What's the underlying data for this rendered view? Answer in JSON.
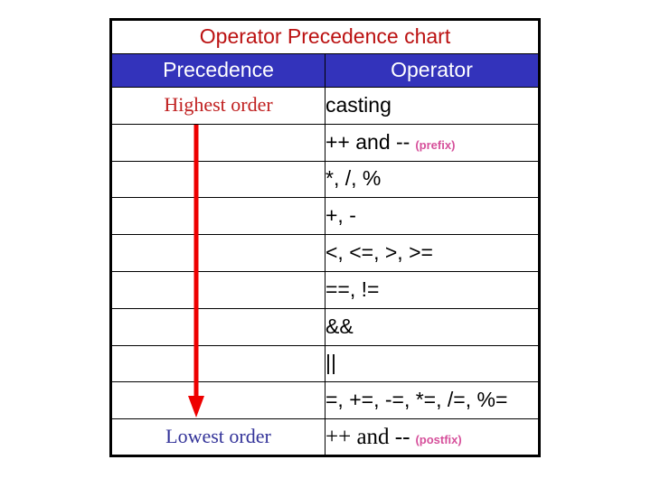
{
  "chart_data": {
    "type": "table",
    "title": "Operator Precedence chart",
    "columns": [
      "Precedence",
      "Operator"
    ],
    "rows": [
      {
        "precedence": "Highest order",
        "operator": "casting",
        "note": ""
      },
      {
        "precedence": "",
        "operator": "++ and --",
        "note": "(prefix)"
      },
      {
        "precedence": "",
        "operator": "*, /, %",
        "note": ""
      },
      {
        "precedence": "",
        "operator": "+, -",
        "note": ""
      },
      {
        "precedence": "",
        "operator": "<, <=, >, >=",
        "note": ""
      },
      {
        "precedence": "",
        "operator": "==, !=",
        "note": ""
      },
      {
        "precedence": "",
        "operator": "&&",
        "note": ""
      },
      {
        "precedence": "",
        "operator": "||",
        "note": ""
      },
      {
        "precedence": "",
        "operator": "=, +=, -=, *=, /=, %=",
        "note": ""
      },
      {
        "precedence": "Lowest order",
        "operator": "++ and  --",
        "note": "(postfix)"
      }
    ],
    "annotations": [
      {
        "name": "precedence-direction-arrow",
        "shape": "down-arrow",
        "color": "#EE0000",
        "meaning": "precedence decreases from top to bottom"
      }
    ],
    "colors": {
      "title_text": "#BB1111",
      "header_fill": "#3333BB",
      "header_text": "#FFFFFF",
      "highest_order_text": "#C02020",
      "lowest_order_text": "#333399",
      "operator_text": "#000000",
      "note_text": "#D6509B",
      "arrow": "#EE0000",
      "border": "#000000",
      "background": "#FFFFFF"
    }
  }
}
